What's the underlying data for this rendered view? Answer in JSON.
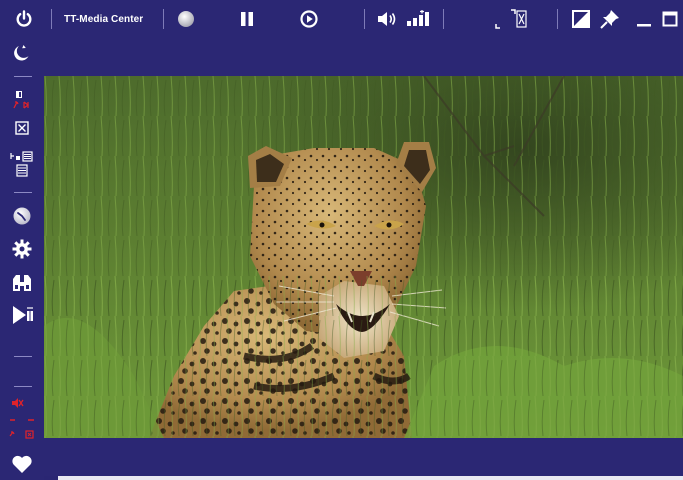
{
  "app": {
    "title": "TT-Media Center"
  },
  "colors": {
    "chrome": "#2b2774",
    "accent_red": "#e0222a",
    "icon": "#ffffff"
  },
  "toolbar": {
    "icons": [
      "power-icon",
      "record-icon",
      "pause-icon",
      "play-icon",
      "volume-icon",
      "volume-level-icon",
      "fullscreen-icon",
      "aspect-icon",
      "pin-icon",
      "minimize-icon",
      "maximize-icon"
    ]
  },
  "sidebar": {
    "icons": [
      "standby-icon",
      "signal-icon",
      "close-x-icon",
      "list-icon",
      "clock-icon",
      "settings-gear-icon",
      "binoculars-icon",
      "play-next-icon",
      "mute-icon",
      "favorite-heart-icon"
    ]
  },
  "video": {
    "subject": "leopard"
  }
}
